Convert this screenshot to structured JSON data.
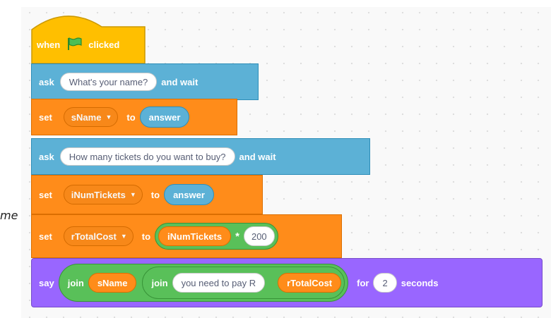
{
  "cropped_caption": "me",
  "script": {
    "hat": {
      "when": "when",
      "clicked": "clicked"
    },
    "ask1": {
      "label": "ask",
      "question": "What's your name?",
      "suffix": "and wait"
    },
    "set1": {
      "label": "set",
      "variable": "sName",
      "to": "to",
      "value": "answer"
    },
    "ask2": {
      "label": "ask",
      "question": "How many tickets do you want to buy?",
      "suffix": "and wait"
    },
    "set2": {
      "label": "set",
      "variable": "iNumTickets",
      "to": "to",
      "value": "answer"
    },
    "set3": {
      "label": "set",
      "variable": "rTotalCost",
      "to": "to",
      "left": "iNumTickets",
      "operator": "*",
      "right": "200"
    },
    "say": {
      "label": "say",
      "join1": "join",
      "var1": "sName",
      "join2": "join",
      "text": "you need to pay R",
      "var2": "rTotalCost",
      "for": "for",
      "seconds_value": "2",
      "seconds": "seconds"
    }
  },
  "colors": {
    "events": "#ffbf00",
    "sensing": "#5cb1d6",
    "variables": "#ff8c1a",
    "looks": "#9966ff",
    "operators": "#59c059"
  },
  "icons": {
    "hat_icon": "green-flag-icon",
    "dropdown_icon": "dropdown-caret-icon"
  }
}
